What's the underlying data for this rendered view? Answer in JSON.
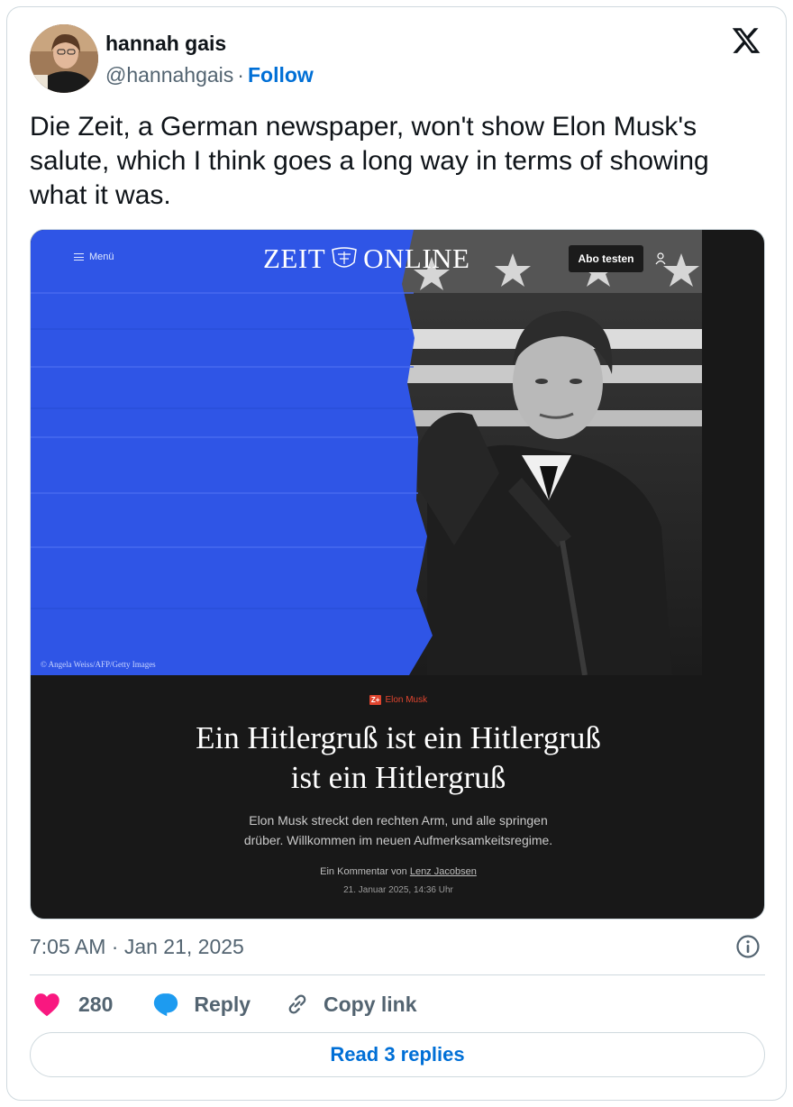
{
  "author": {
    "display_name": "hannah gais",
    "handle": "@hannahgais",
    "separator": "·",
    "follow_label": "Follow"
  },
  "platform_icon": "x-logo-icon",
  "tweet": {
    "text": "Die Zeit, a German newspaper, won't show Elon Musk's salute, which I think goes a long way in terms of showing what it was."
  },
  "embedded_article": {
    "menu_label": "Menü",
    "logo_left": "ZEIT",
    "logo_right": "ONLINE",
    "subscribe_label": "Abo testen",
    "photo_credit": "© Angela Weiss/AFP/Getty Images",
    "kicker_badge": "Z+",
    "kicker_topic": "Elon Musk",
    "headline_line1": "Ein Hitlergruß ist ein Hitlergruß",
    "headline_line2": "ist ein Hitlergruß",
    "standfirst_line1": "Elon Musk streckt den rechten Arm, und alle springen",
    "standfirst_line2": "drüber. Willkommen im neuen Aufmerksamkeitsregime.",
    "byline_prefix": "Ein Kommentar von",
    "byline_author": "Lenz Jacobsen",
    "dateline": "21. Januar 2025, 14:36 Uhr",
    "colors": {
      "tape_blue": "#2f55e6",
      "background": "#181818",
      "kicker_red": "#e0452f"
    }
  },
  "footer": {
    "timestamp": "7:05 AM · Jan 21, 2025",
    "likes_count": "280",
    "reply_label": "Reply",
    "copy_link_label": "Copy link",
    "read_replies_label": "Read 3 replies"
  },
  "colors": {
    "link_blue": "#006fd6",
    "heart_pink": "#f91880",
    "reply_blue": "#1d9bf0",
    "muted_text": "#536471",
    "border": "#cfd9de"
  }
}
